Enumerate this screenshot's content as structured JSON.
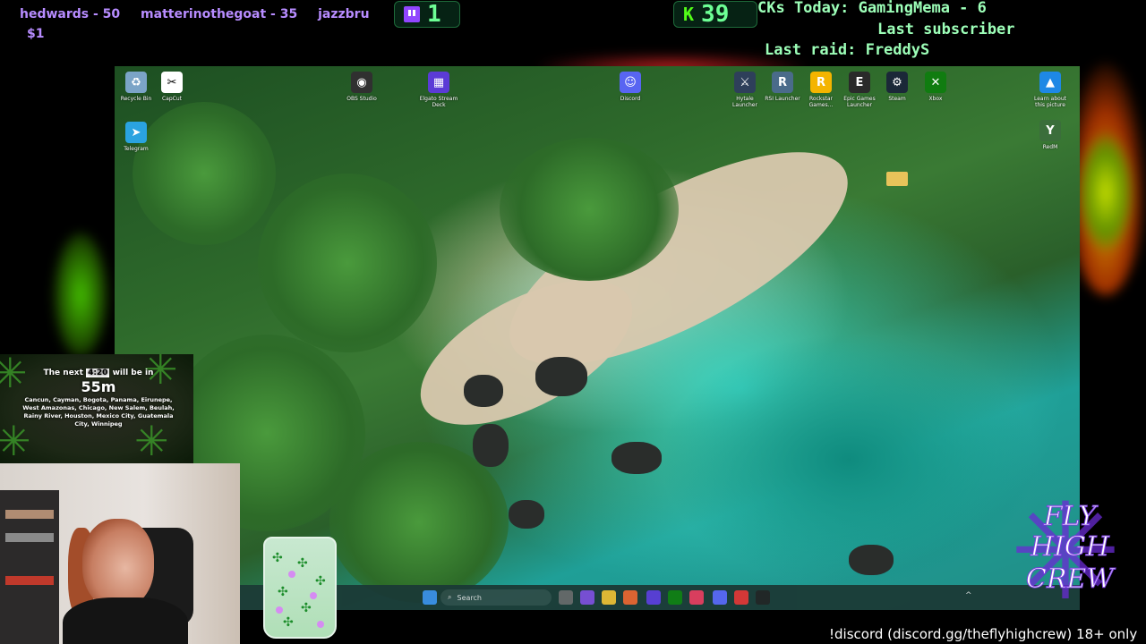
{
  "overlay": {
    "subs_ticker": {
      "items": [
        "hedwards - 50",
        "matterinothegoat - 35",
        "jazzbru"
      ],
      "line2": "$1"
    },
    "twitch_count": "1",
    "kick_count": "39",
    "kicks_today": "CKs Today: GamingMema - 6",
    "last_subscriber": "Last subscriber",
    "last_raid": "Last raid: FreddyS"
  },
  "desktop": {
    "icons": [
      {
        "label": "Recycle Bin",
        "icon": "recycle-bin-icon",
        "color": "#7ba4c7",
        "glyph": "♻"
      },
      {
        "label": "CapCut",
        "icon": "capcut-icon",
        "color": "#ffffff",
        "glyph": "✂"
      },
      {
        "label": "Telegram",
        "icon": "telegram-icon",
        "color": "#2aa3e0",
        "glyph": "➤"
      },
      {
        "label": "OBS Studio",
        "icon": "obs-icon",
        "color": "#303030",
        "glyph": "◉"
      },
      {
        "label": "Elgato Stream Deck",
        "icon": "stream-deck-icon",
        "color": "#5b3bd6",
        "glyph": "▦"
      },
      {
        "label": "Discord",
        "icon": "discord-icon",
        "color": "#5865f2",
        "glyph": "☺"
      },
      {
        "label": "Hytale Launcher",
        "icon": "hytale-icon",
        "color": "#2e3f5a",
        "glyph": "⚔"
      },
      {
        "label": "RSI Launcher",
        "icon": "rsi-launcher-icon",
        "color": "#4a6b8a",
        "glyph": "R"
      },
      {
        "label": "Rockstar Games...",
        "icon": "rockstar-icon",
        "color": "#f4b400",
        "glyph": "R"
      },
      {
        "label": "Epic Games Launcher",
        "icon": "epic-games-icon",
        "color": "#2a2a2a",
        "glyph": "E"
      },
      {
        "label": "Steam",
        "icon": "steam-icon",
        "color": "#1b2838",
        "glyph": "⚙"
      },
      {
        "label": "Xbox",
        "icon": "xbox-icon",
        "color": "#107c10",
        "glyph": "✕"
      },
      {
        "label": "Learn about this picture",
        "icon": "learn-picture-icon",
        "color": "#1e88e5",
        "glyph": "▲"
      },
      {
        "label": "RedM",
        "icon": "redm-icon",
        "color": "#3b6e3b",
        "glyph": "Y"
      }
    ],
    "taskbar": {
      "search_placeholder": "Search"
    }
  },
  "weed_timer": {
    "prefix": "The next",
    "badge": "4:20",
    "suffix": "will be in",
    "time": "55m",
    "cities": "Cancun, Cayman, Bogota, Panama, Eirunepe, West Amazonas, Chicago, New Salem, Beulah, Rainy River, Houston, Mexico City, Guatemala City, Winnipeg"
  },
  "logo": {
    "line1": "FLY",
    "line2": "HIGH",
    "line3": "CREW"
  },
  "discord_ticker": "!discord (discord.gg/theflyhighcrew) 18+ only",
  "colors": {
    "counter_green": "#6dff95",
    "sub_purple": "#b78cff",
    "logo_purple": "#6a2bd4"
  }
}
